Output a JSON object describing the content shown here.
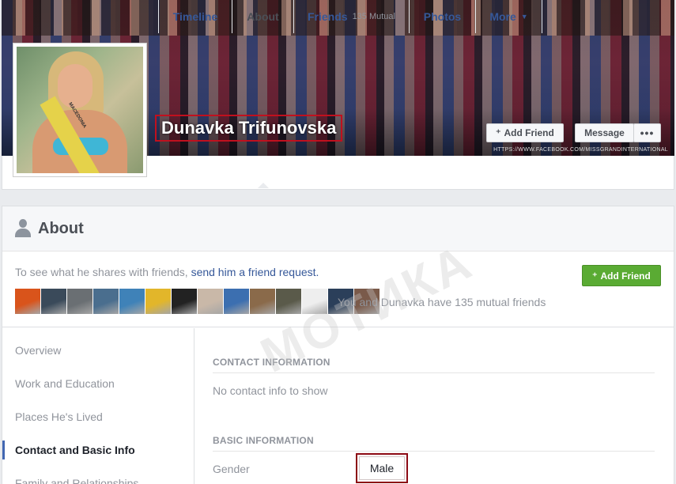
{
  "profile": {
    "name": "Dunavka Trifunovska",
    "cover_credit": "HTTPS://WWW.FACEBOOK.COM/MISSGRANDINTERNATIONAL",
    "sash_text": "MACEDONIA"
  },
  "cover_buttons": {
    "add_friend": "Add Friend",
    "message": "Message",
    "more": "•••"
  },
  "nav": {
    "tabs": [
      {
        "label": "Timeline"
      },
      {
        "label": "About"
      },
      {
        "label": "Friends",
        "count": "135 Mutual"
      },
      {
        "label": "Photos"
      },
      {
        "label": "More",
        "caret": "▼"
      }
    ]
  },
  "about": {
    "title": "About",
    "prompt_text": "To see what he shares with friends, ",
    "prompt_link": "send him a friend request.",
    "add_friend": "Add Friend",
    "mutual_text": "You and Dunavka have 135 mutual friends",
    "thumb_colors": [
      "#d9541b",
      "#3a4a5a",
      "#6a6f73",
      "#4a6e8e",
      "#3f82b8",
      "#e2b62a",
      "#222222",
      "#c9b8a8",
      "#3c6fb0",
      "#8a6a4a",
      "#5a5a4a",
      "#eeeeee",
      "#2b3f5a",
      "#7a5a4a"
    ]
  },
  "sidebar": {
    "items": [
      {
        "label": "Overview"
      },
      {
        "label": "Work and Education"
      },
      {
        "label": "Places He's Lived"
      },
      {
        "label": "Contact and Basic Info"
      },
      {
        "label": "Family and Relationships"
      }
    ]
  },
  "contact": {
    "header": "CONTACT INFORMATION",
    "empty": "No contact info to show"
  },
  "basic": {
    "header": "BASIC INFORMATION",
    "gender_label": "Gender",
    "gender_value": "Male"
  },
  "watermark": "МОТИКА",
  "colors": {
    "link": "#365899",
    "green": "#5aab33",
    "highlight_box": "#c0101e"
  }
}
